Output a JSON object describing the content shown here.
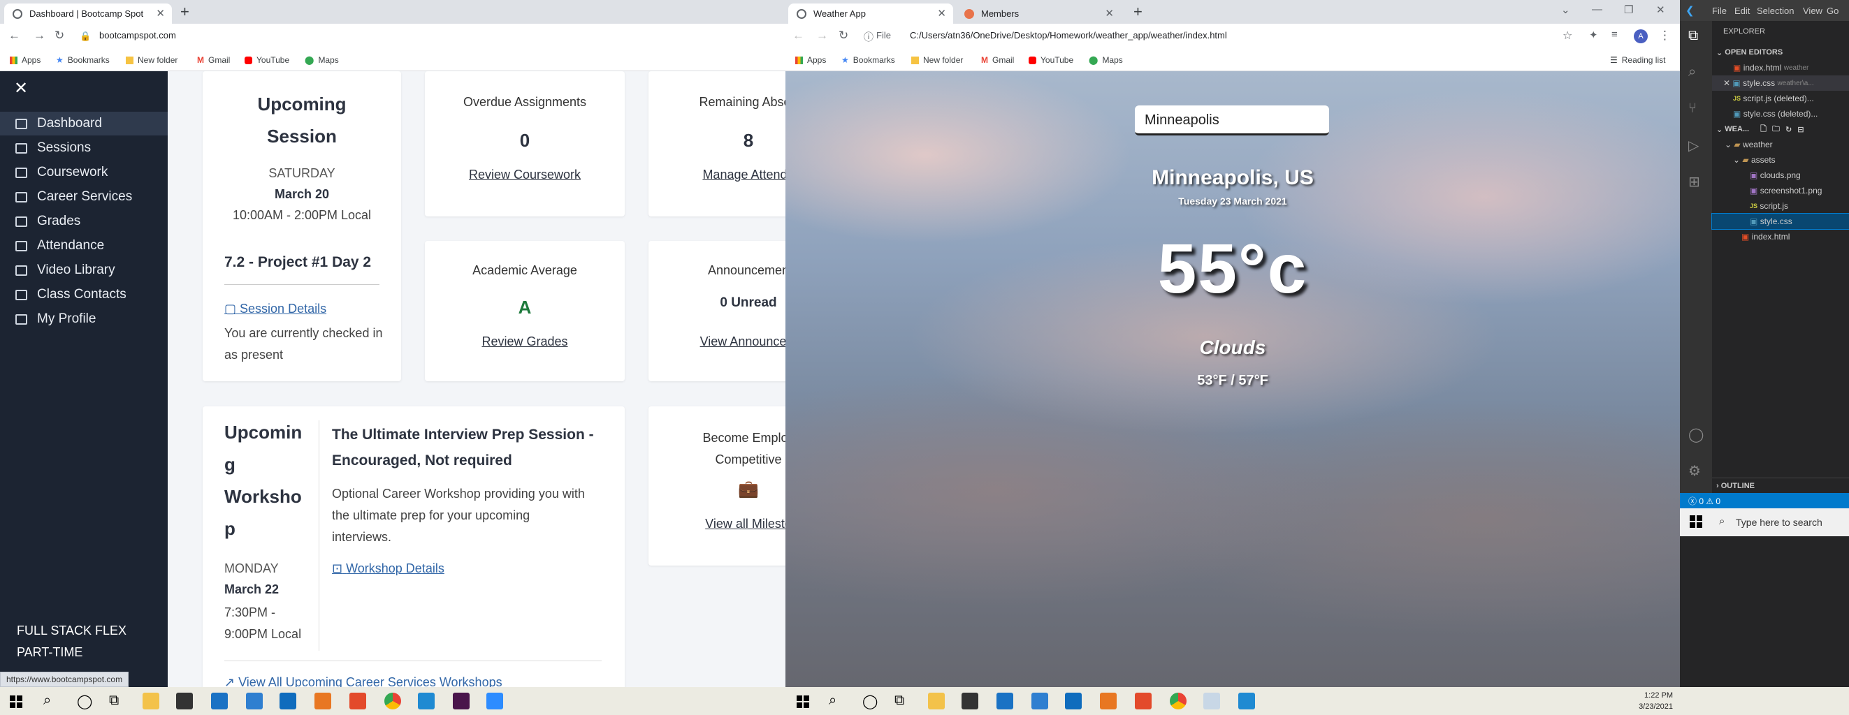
{
  "bootcamp_window": {
    "tab_title": "Dashboard | Bootcamp Spot",
    "url": "bootcampspot.com",
    "bookmarks": [
      "Apps",
      "Bookmarks",
      "New folder",
      "Gmail",
      "YouTube",
      "Maps"
    ],
    "menu": [
      "Dashboard",
      "Sessions",
      "Coursework",
      "Career Services",
      "Grades",
      "Attendance",
      "Video Library",
      "Class Contacts",
      "My Profile"
    ],
    "program": [
      "FULL STACK FLEX",
      "PART-TIME"
    ],
    "upcoming_session": {
      "title_line1": "Upcoming",
      "title_line2": "Session",
      "day": "SATURDAY",
      "date": "March 20",
      "time": "10:00AM - 2:00PM Local",
      "class": "7.2 - Project #1 Day 2",
      "details_link": "Session Details",
      "status": "You are currently checked in as present"
    },
    "overdue": {
      "label": "Overdue Assignments",
      "value": "0",
      "link": "Review Coursework"
    },
    "absences": {
      "label": "Remaining Absen",
      "value": "8",
      "link": "Manage Attenda"
    },
    "academic": {
      "label": "Academic Average",
      "value": "A",
      "link": "Review Grades"
    },
    "announcements": {
      "label": "Announcemen",
      "value": "0 Unread",
      "link": "View Announcem"
    },
    "workshop": {
      "title_lines": [
        "Upcomin",
        "g",
        "Worksho",
        "p"
      ],
      "day": "MONDAY",
      "date": "March 22",
      "time_lines": [
        "7:30PM -",
        "9:00PM Local"
      ],
      "name_line1": "The Ultimate Interview Prep Session -",
      "name_line2": "Encouraged, Not required",
      "desc_lines": [
        "Optional Career Workshop providing you with",
        "the ultimate prep for your upcoming",
        "interviews."
      ],
      "details_link": "Workshop Details",
      "all_link": "View All Upcoming Career Services Workshops"
    },
    "employ": {
      "label_line1": "Become Employ",
      "label_line2": "Competitive",
      "link": "View all Milesto"
    },
    "status_url": "https://www.bootcampspot.com"
  },
  "weather_window": {
    "tabs": [
      "Weather App",
      "Members"
    ],
    "url_prefix": "File",
    "url": "C:/Users/atn36/OneDrive/Desktop/Homework/weather_app/weather/index.html",
    "bookmarks": [
      "Apps",
      "Bookmarks",
      "New folder",
      "Gmail",
      "YouTube",
      "Maps"
    ],
    "reading_list": "Reading list",
    "profile_initial": "A",
    "search_value": "Minneapolis",
    "city": "Minneapolis, US",
    "date": "Tuesday 23 March 2021",
    "temp": "55°c",
    "condition": "Clouds",
    "range": "53°F / 57°F"
  },
  "vscode": {
    "menu": [
      "File",
      "Edit",
      "Selection",
      "View",
      "Go"
    ],
    "explorer": "EXPLORER",
    "open_editors": "OPEN EDITORS",
    "open_files": [
      {
        "name": "index.html",
        "hint": "weather",
        "icon": "html"
      },
      {
        "name": "style.css",
        "hint": "weather\\a...",
        "icon": "css"
      },
      {
        "name": "script.js (deleted)...",
        "hint": "",
        "icon": "js"
      },
      {
        "name": "style.css (deleted)...",
        "hint": "",
        "icon": "css"
      }
    ],
    "workspace": "WEA...",
    "tree": [
      {
        "name": "weather",
        "level": 1,
        "icon": "folder"
      },
      {
        "name": "assets",
        "level": 2,
        "icon": "folder"
      },
      {
        "name": "clouds.png",
        "level": 3,
        "icon": "img"
      },
      {
        "name": "screenshot1.png",
        "level": 3,
        "icon": "img"
      },
      {
        "name": "script.js",
        "level": 3,
        "icon": "js"
      },
      {
        "name": "style.css",
        "level": 3,
        "icon": "css"
      },
      {
        "name": "index.html",
        "level": 2,
        "icon": "html"
      }
    ],
    "outline": "OUTLINE",
    "status": "ⓧ 0 ⚠ 0",
    "search_placeholder": "Type here to search"
  },
  "taskbar": {
    "time": "1:22 PM",
    "date": "3/23/2021"
  }
}
